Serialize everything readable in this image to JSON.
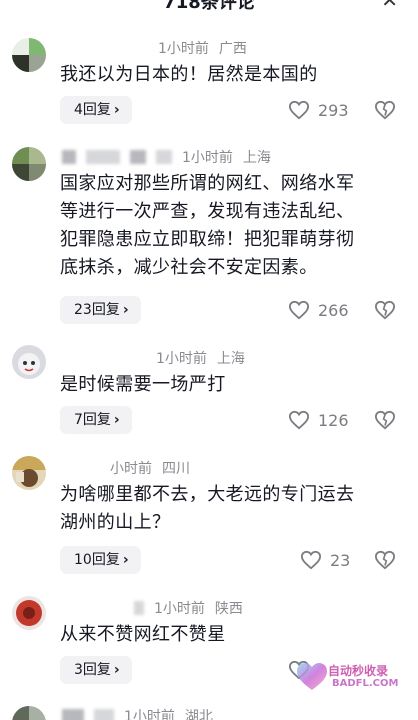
{
  "header": {
    "title": "718条评论",
    "close_icon": "close-icon"
  },
  "comments": [
    {
      "time": "1小时前",
      "location": "广西",
      "text_lines": [
        "我还以为日本的！居然是本国的"
      ],
      "reply_label": "4回复",
      "likes": "293"
    },
    {
      "time": "1小时前",
      "location": "上海",
      "text_lines": [
        "国家应对那些所谓的网红、网络水军",
        "等进行一次严查，发现有违法乱纪、",
        "犯罪隐患应立即取缔！把犯罪萌芽彻",
        "底抹杀，减少社会不安定因素。"
      ],
      "reply_label": "23回复",
      "likes": "266"
    },
    {
      "time": "1小时前",
      "location": "上海",
      "text_lines": [
        "是时候需要一场严打"
      ],
      "reply_label": "7回复",
      "likes": "126"
    },
    {
      "time": "小时前",
      "location": "四川",
      "text_lines": [
        "为啥哪里都不去，大老远的专门运去",
        "湖州的山上？"
      ],
      "reply_label": "10回复",
      "likes": "23"
    },
    {
      "time": "1小时前",
      "location": "陕西",
      "text_lines": [
        "从来不赞网红不赞星"
      ],
      "reply_label": "3回复",
      "likes": ""
    },
    {
      "time": "1小时前",
      "location": "湖北",
      "text_lines": [],
      "reply_label": "",
      "likes": ""
    }
  ],
  "watermark": {
    "line1": "自动秒收录",
    "line2": "BADFL.COM"
  },
  "colors": {
    "text": "#161823",
    "meta": "#8a8b91",
    "reply_bg": "#f2f2f4",
    "icon": "#7b7c82"
  }
}
